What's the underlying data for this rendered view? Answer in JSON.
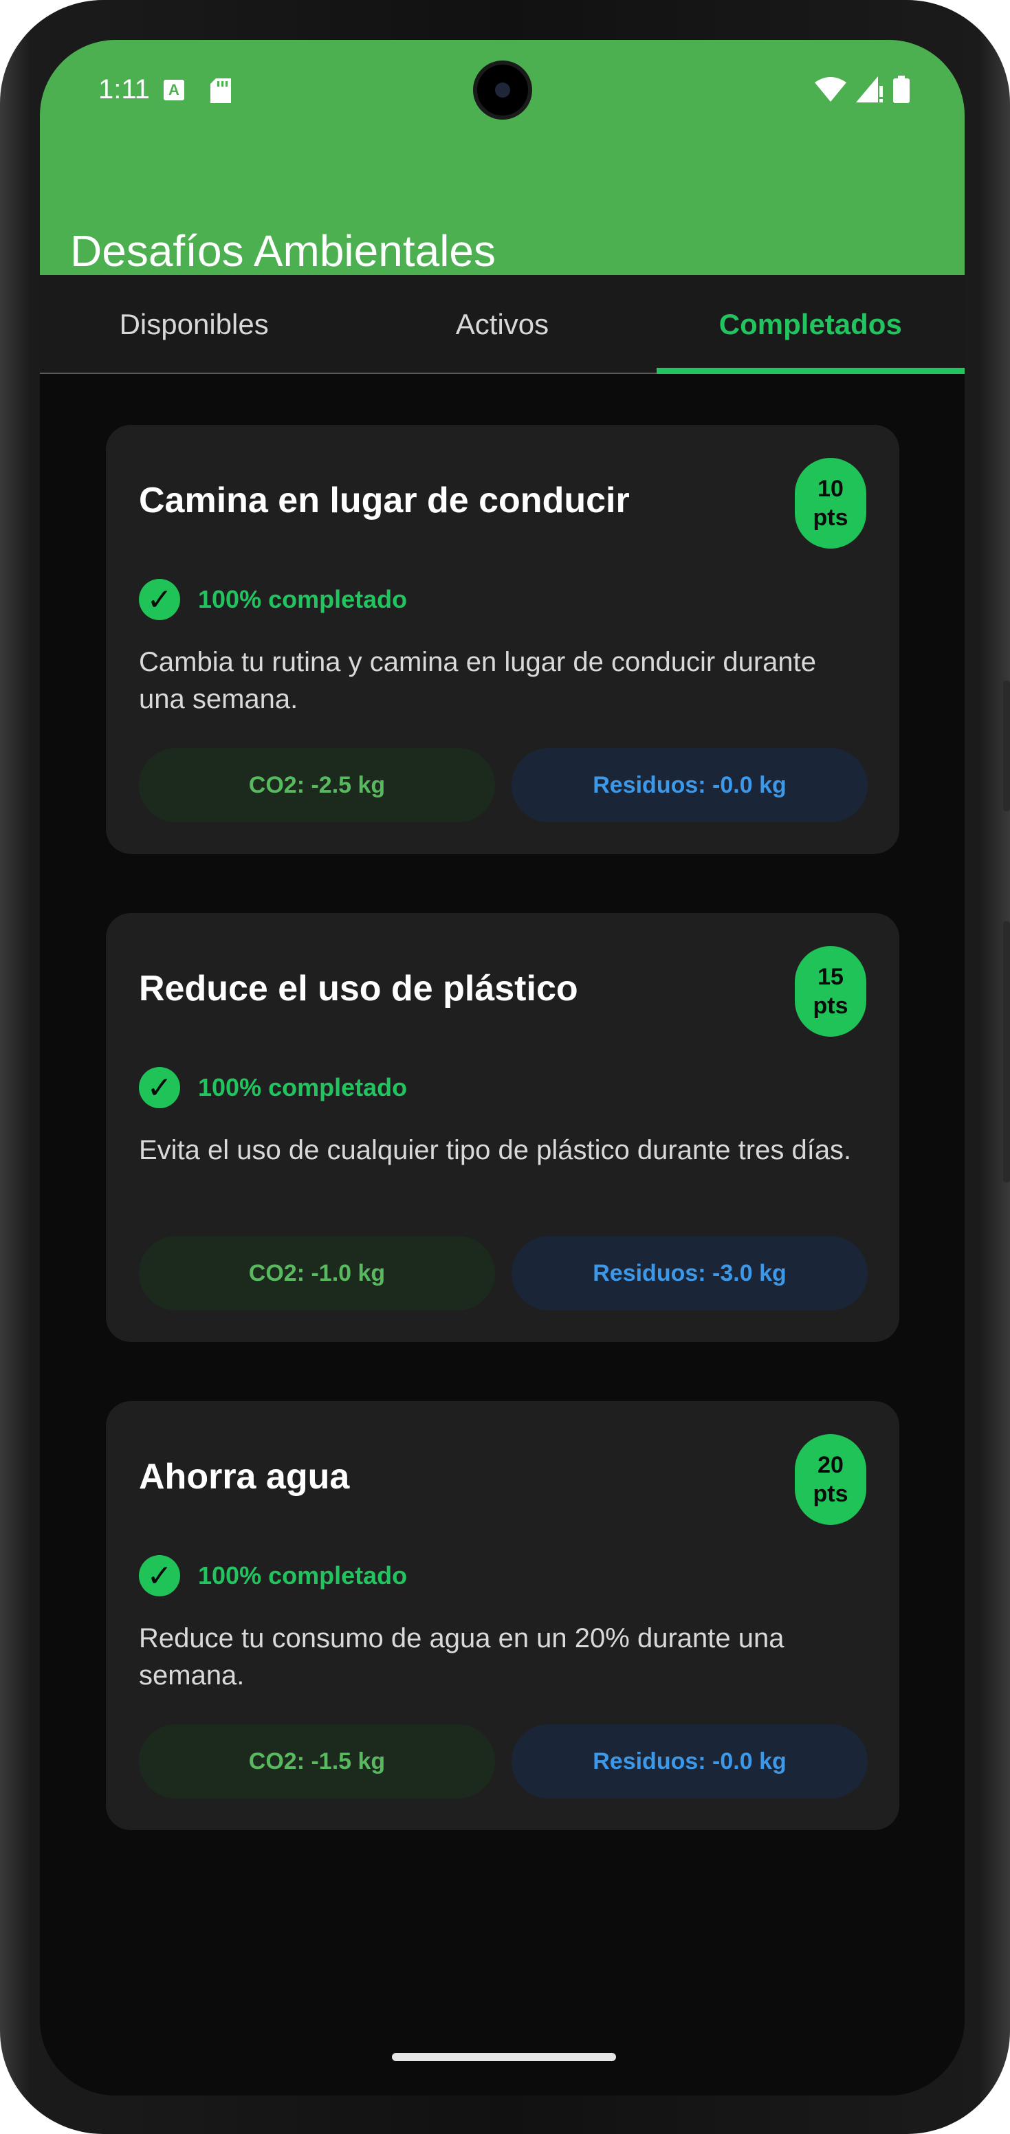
{
  "status_bar": {
    "time": "1:11",
    "a_icon": "A"
  },
  "app_bar": {
    "title": "Desafíos Ambientales"
  },
  "tabs": [
    {
      "label": "Disponibles",
      "active": false
    },
    {
      "label": "Activos",
      "active": false
    },
    {
      "label": "Completados",
      "active": true
    }
  ],
  "challenges": [
    {
      "title": "Camina en lugar de conducir",
      "points_value": "10",
      "points_unit": "pts",
      "progress": "100% completado",
      "description": "Cambia tu rutina y camina en lugar de conducir durante una semana.",
      "co2": "CO2: -2.5 kg",
      "waste": "Residuos: -0.0 kg"
    },
    {
      "title": "Reduce el uso de plástico",
      "points_value": "15",
      "points_unit": "pts",
      "progress": "100% completado",
      "description": "Evita el uso de cualquier tipo de plástico durante tres días.",
      "co2": "CO2: -1.0 kg",
      "waste": "Residuos: -3.0 kg"
    },
    {
      "title": "Ahorra agua",
      "points_value": "20",
      "points_unit": "pts",
      "progress": "100% completado",
      "description": "Reduce tu consumo de agua en un 20% durante una semana.",
      "co2": "CO2: -1.5 kg",
      "waste": "Residuos: -0.0 kg"
    }
  ],
  "colors": {
    "primary": "#4caf50",
    "accent": "#21c45e",
    "co2_chip_bg": "#1c2a1e",
    "waste_chip_bg": "#1a2538"
  }
}
